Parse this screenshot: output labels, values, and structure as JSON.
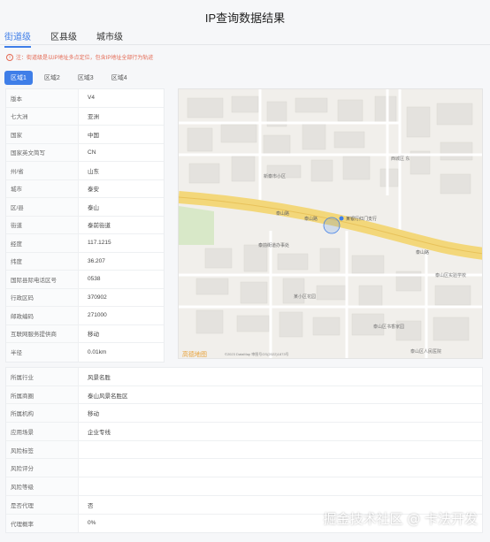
{
  "title": "IP查询数据结果",
  "level_tabs": [
    {
      "label": "街道级",
      "active": true
    },
    {
      "label": "区县级",
      "active": false
    },
    {
      "label": "城市级",
      "active": false
    }
  ],
  "notice": "注：街道级是以IP地址多点定位，包含IP地址全部行为轨迹",
  "region_tabs": [
    {
      "label": "区域1",
      "active": true
    },
    {
      "label": "区域2",
      "active": false
    },
    {
      "label": "区域3",
      "active": false
    },
    {
      "label": "区域4",
      "active": false
    }
  ],
  "info_rows": [
    {
      "key": "版本",
      "value": "V4"
    },
    {
      "key": "七大洲",
      "value": "亚洲"
    },
    {
      "key": "国家",
      "value": "中国"
    },
    {
      "key": "国家英文简写",
      "value": "CN"
    },
    {
      "key": "州/省",
      "value": "山东"
    },
    {
      "key": "城市",
      "value": "泰安"
    },
    {
      "key": "区/县",
      "value": "泰山"
    },
    {
      "key": "街道",
      "value": "泰前街道"
    },
    {
      "key": "经度",
      "value": "117.1215"
    },
    {
      "key": "纬度",
      "value": "36.207"
    },
    {
      "key": "国际县际电话区号",
      "value": "0538"
    },
    {
      "key": "行政区码",
      "value": "370902"
    },
    {
      "key": "邮政编码",
      "value": "271000"
    },
    {
      "key": "互联网服务提供商",
      "value": "移动"
    },
    {
      "key": "半径",
      "value": "0.01km"
    }
  ],
  "extra_rows": [
    {
      "key": "所属行业",
      "value": "风景名胜"
    },
    {
      "key": "所属商圈",
      "value": "泰山风景名胜区"
    },
    {
      "key": "所属机构",
      "value": "移动"
    },
    {
      "key": "应用场景",
      "value": "企业专线"
    },
    {
      "key": "风险标签",
      "value": ""
    },
    {
      "key": "风险评分",
      "value": ""
    },
    {
      "key": "风险等级",
      "value": ""
    },
    {
      "key": "是否代理",
      "value": "否"
    },
    {
      "key": "代理概率",
      "value": "0%"
    }
  ],
  "map": {
    "labels": {
      "road1": "泰山路",
      "road2": "泰山路",
      "road3": "泰山路",
      "bank": "某银行红门支行",
      "office": "泰前街道办事处",
      "east": "西城区 东",
      "sw": "新泰市小区",
      "school": "泰山区实验学校",
      "se1": "泰山区书香家园",
      "se2": "泰山区人民医院",
      "se3": "某小区花园",
      "copyright": "©2023 DataMap 审图号GS(2022)1873号"
    },
    "logo": "高德地图"
  },
  "watermark": "掘金技术社区 @ 卡法开发",
  "colors": {
    "accent": "#3f7ee8",
    "notice": "#e46a54",
    "road": "#f3d77a"
  }
}
